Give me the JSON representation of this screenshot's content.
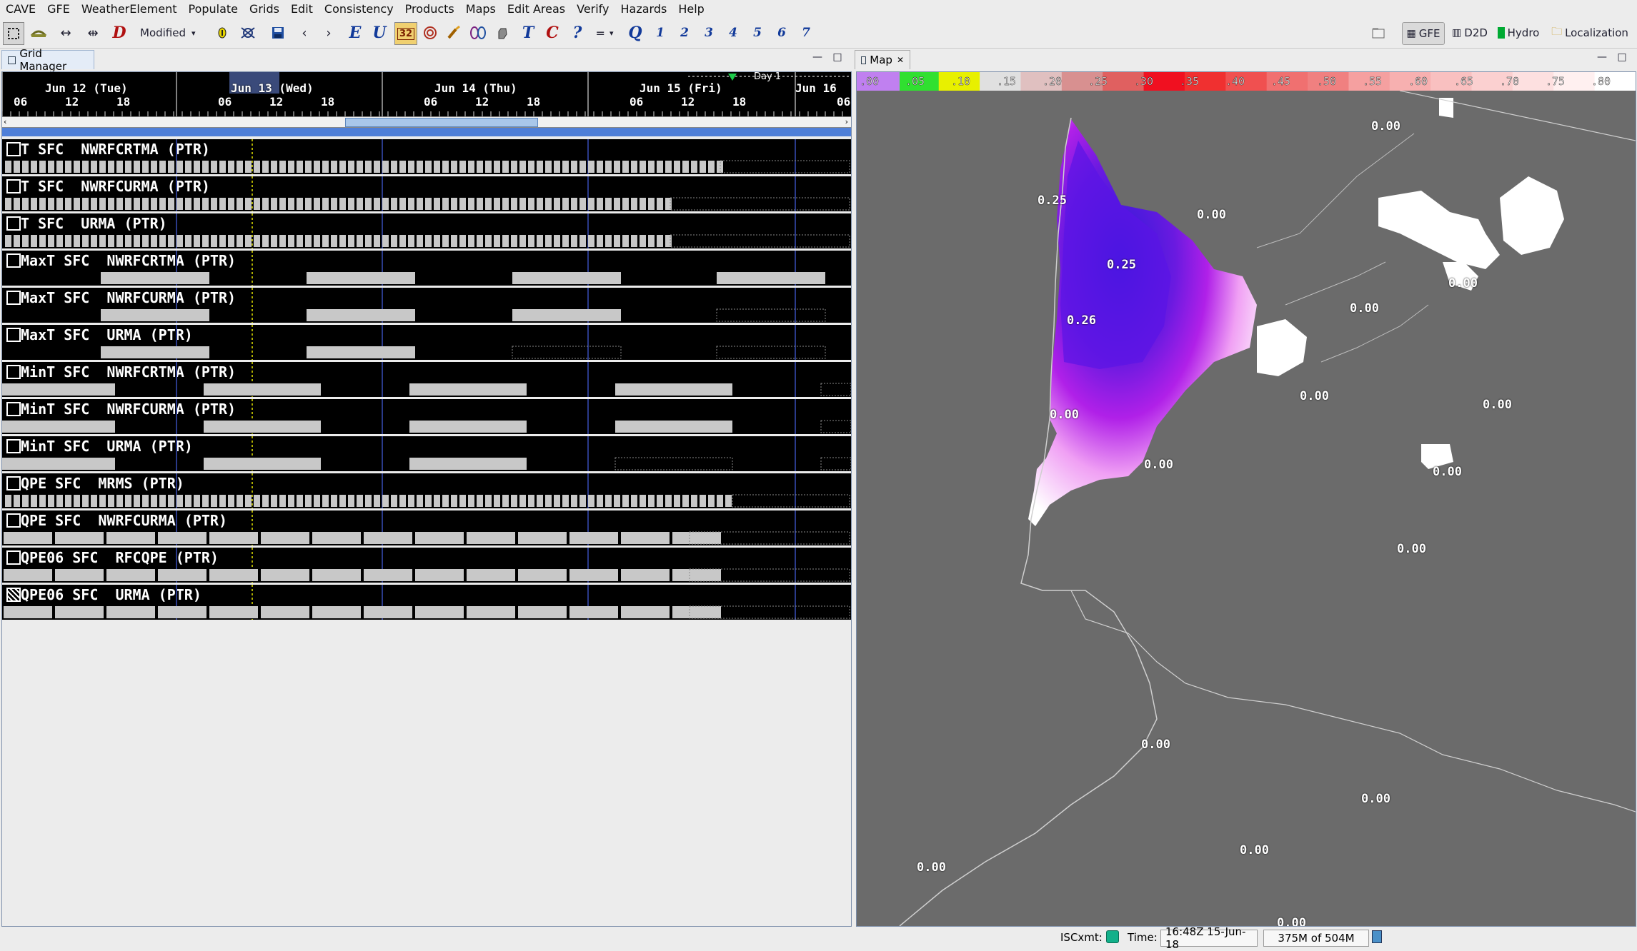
{
  "menubar": {
    "items": [
      "CAVE",
      "GFE",
      "WeatherElement",
      "Populate",
      "Grids",
      "Edit",
      "Consistency",
      "Products",
      "Maps",
      "Edit Areas",
      "Verify",
      "Hazards",
      "Help"
    ]
  },
  "toolbar": {
    "mode_dropdown": "Modified",
    "btn_E": "E",
    "btn_U": "U",
    "btn_32": "32",
    "btn_T": "T",
    "btn_C": "C",
    "btn_question": "?",
    "btn_equals": "=",
    "btn_Q": "Q",
    "btn_D": "D",
    "numbers": [
      "1",
      "2",
      "3",
      "4",
      "5",
      "6",
      "7"
    ],
    "perspectives": {
      "gfe": "GFE",
      "d2d": "D2D",
      "hydro": "Hydro",
      "localization": "Localization"
    }
  },
  "grid_manager": {
    "tab_title": "Grid Manager",
    "days": [
      "Jun 12 (Tue)",
      "Jun 13 (Wed)",
      "Jun 14 (Thu)",
      "Jun 15 (Fri)",
      "Jun 16"
    ],
    "hours": [
      "06",
      "12",
      "18",
      "06",
      "12",
      "18",
      "06",
      "12",
      "18",
      "06",
      "12",
      "18",
      "06"
    ],
    "day1_label": "Day 1",
    "rows": [
      {
        "label": "T SFC  NWRFCRTMA (PTR)"
      },
      {
        "label": "T SFC  NWRFCURMA (PTR)"
      },
      {
        "label": "T SFC  URMA (PTR)"
      },
      {
        "label": "MaxT SFC  NWRFCRTMA (PTR)"
      },
      {
        "label": "MaxT SFC  NWRFCURMA (PTR)"
      },
      {
        "label": "MaxT SFC  URMA (PTR)"
      },
      {
        "label": "MinT SFC  NWRFCRTMA (PTR)"
      },
      {
        "label": "MinT SFC  NWRFCURMA (PTR)"
      },
      {
        "label": "MinT SFC  URMA (PTR)"
      },
      {
        "label": "QPE SFC  MRMS (PTR)"
      },
      {
        "label": "QPE SFC  NWRFCURMA (PTR)"
      },
      {
        "label": "QPE06 SFC  RFCQPE (PTR)"
      },
      {
        "label": "QPE06 SFC  URMA (PTR)"
      }
    ]
  },
  "map": {
    "tab_title": "Map",
    "colorbar_labels": [
      ".00",
      ".05",
      ".10",
      ".15",
      ".20",
      ".25",
      ".30",
      ".35",
      ".40",
      ".45",
      ".50",
      ".55",
      ".60",
      ".65",
      ".70",
      ".75",
      ".80"
    ],
    "values": [
      {
        "text": "0.00"
      },
      {
        "text": "0.25"
      },
      {
        "text": "0.00"
      },
      {
        "text": "0.25"
      },
      {
        "text": "0.00"
      },
      {
        "text": "0.00"
      },
      {
        "text": "0.26"
      },
      {
        "text": "0.00"
      },
      {
        "text": "0.00"
      },
      {
        "text": "0.00"
      },
      {
        "text": "0.00"
      },
      {
        "text": "0.00"
      },
      {
        "text": "0.00"
      },
      {
        "text": "0.00"
      },
      {
        "text": "0.00"
      },
      {
        "text": "0.00"
      },
      {
        "text": "0.00"
      },
      {
        "text": "0.00"
      }
    ]
  },
  "status": {
    "iscxmt_label": "ISCxmt:",
    "time_label": "Time:",
    "time_value": "16:48Z 15-Jun-18",
    "memory": "375M of 504M"
  }
}
